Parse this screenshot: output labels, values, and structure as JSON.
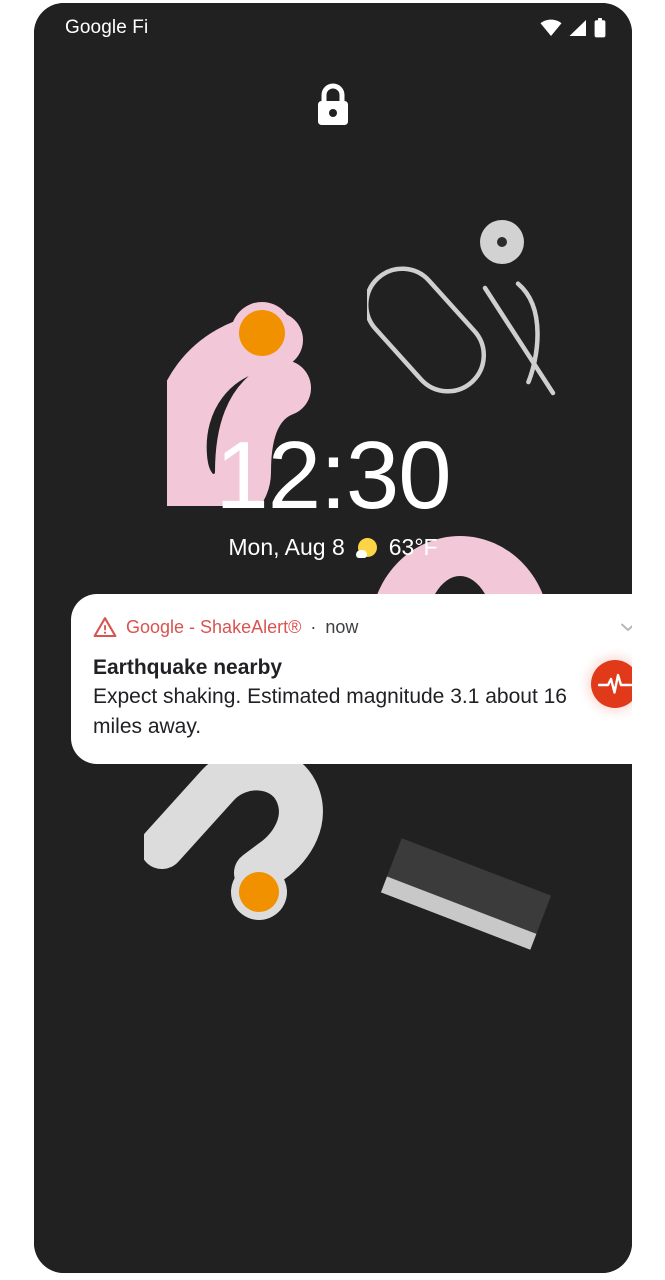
{
  "device": {
    "screen_background": "#212121",
    "frame_background": "#ffffff"
  },
  "status_bar": {
    "carrier": "Google Fi",
    "icons": [
      {
        "name": "wifi-icon",
        "label": "Wi-Fi"
      },
      {
        "name": "cellular-signal-icon",
        "label": "Cellular signal"
      },
      {
        "name": "battery-icon",
        "label": "Battery"
      }
    ]
  },
  "lock_screen": {
    "lock_icon": "lock-icon",
    "clock": "12:30",
    "date": "Mon, Aug 8",
    "weather_icon": "partly-sunny-icon",
    "temperature": "63°F"
  },
  "notification": {
    "app_name": "Google - ShakeAlert®",
    "separator": "·",
    "time": "now",
    "expand_icon": "chevron-down-icon",
    "title": "Earthquake nearby",
    "body": "Expect shaking. Estimated magnitude 3.1 about 16 miles away.",
    "badge_icon": "seismograph-icon",
    "colors": {
      "card": "#ffffff",
      "app_name": "#D9534F",
      "title": "#202124",
      "badge": "#E03A1B",
      "warning_icon": "#D9534F"
    }
  },
  "wallpaper": {
    "colors": {
      "background": "#212121",
      "pink": "#F2C8D9",
      "orange": "#F29100",
      "light_gray": "#DCDCDC",
      "mid_gray": "#D2D2D2",
      "slab_dark": "#3B3B3B",
      "slab_stripe": "#C8C8C8"
    },
    "shapes": [
      {
        "name": "pink-arc",
        "description": "pink C-shaped arc with orange dot"
      },
      {
        "name": "pill-outline",
        "description": "rotated gray stadium outline"
      },
      {
        "name": "gray-disc",
        "description": "gray circle with dark center dot"
      },
      {
        "name": "pink-arch",
        "description": "pink arch behind weather text"
      },
      {
        "name": "hook-shape",
        "description": "light gray hook with orange dot"
      },
      {
        "name": "dark-slab",
        "description": "rotated dark rectangle with light stripe"
      }
    ]
  }
}
